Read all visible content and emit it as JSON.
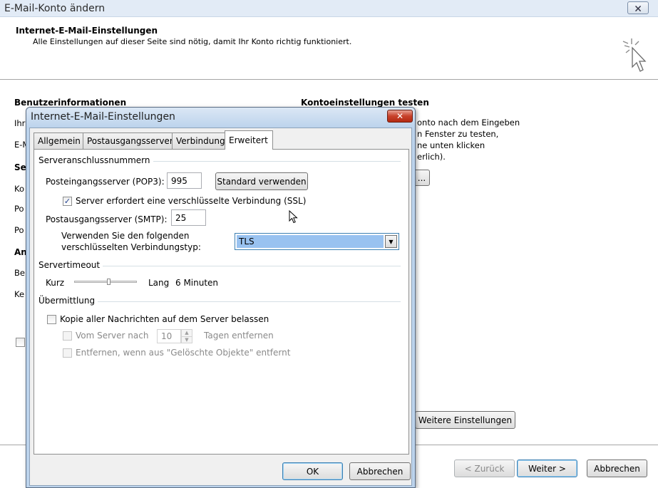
{
  "window": {
    "title": "E-Mail-Konto ändern",
    "close_glyph": "🗙"
  },
  "header": {
    "title": "Internet-E-Mail-Einstellungen",
    "subtitle": "Alle Einstellungen auf dieser Seite sind nötig, damit Ihr Konto richtig funktioniert.",
    "icon": "wand-cursor-icon"
  },
  "background": {
    "benutzer_heading": "Benutzerinformationen",
    "konto_heading": "Kontoeinstellungen testen",
    "left_fragments": [
      "Ihr",
      "E-M",
      "Se",
      "Ko",
      "Po",
      "Po",
      "An",
      "Be",
      "Ke"
    ],
    "right_lines": [
      "onto nach dem Eingeben",
      "n Fenster zu testen,",
      "ne unten klicken",
      "erlich)."
    ],
    "test_button_fragment": "...",
    "weitere_button": "Weitere Einstellungen"
  },
  "footer": {
    "back": "< Zurück",
    "next": "Weiter >",
    "cancel": "Abbrechen"
  },
  "dialog": {
    "title": "Internet-E-Mail-Einstellungen",
    "close_glyph": "✕",
    "tabs": [
      {
        "label": "Allgemein"
      },
      {
        "label": "Postausgangsserver"
      },
      {
        "label": "Verbindung"
      },
      {
        "label": "Erweitert"
      }
    ],
    "active_tab": "Erweitert",
    "group_ports": "Serveranschlussnummern",
    "pop3_label": "Posteingangsserver (POP3):",
    "pop3_value": "995",
    "default_button": "Standard verwenden",
    "ssl_label": "Server erfordert eine verschlüsselte Verbindung (SSL)",
    "ssl_checked": "✓",
    "smtp_label": "Postausgangsserver (SMTP):",
    "smtp_value": "25",
    "enc_label_1": "Verwenden Sie den folgenden",
    "enc_label_2": "verschlüsselten Verbindungstyp:",
    "enc_value": "TLS",
    "group_timeout": "Servertimeout",
    "timeout_short": "Kurz",
    "timeout_long": "Lang",
    "timeout_value": "6 Minuten",
    "timeout_level": 0.55,
    "group_delivery": "Übermittlung",
    "keep_copy_label": "Kopie aller Nachrichten auf dem Server belassen",
    "remove_after_label": "Vom Server nach",
    "remove_days": "10",
    "remove_days_suffix": "Tagen entfernen",
    "remove_deleted_label": "Entfernen, wenn aus \"Gelöschte Objekte\" entfernt",
    "ok": "OK",
    "cancel": "Abbrechen"
  }
}
